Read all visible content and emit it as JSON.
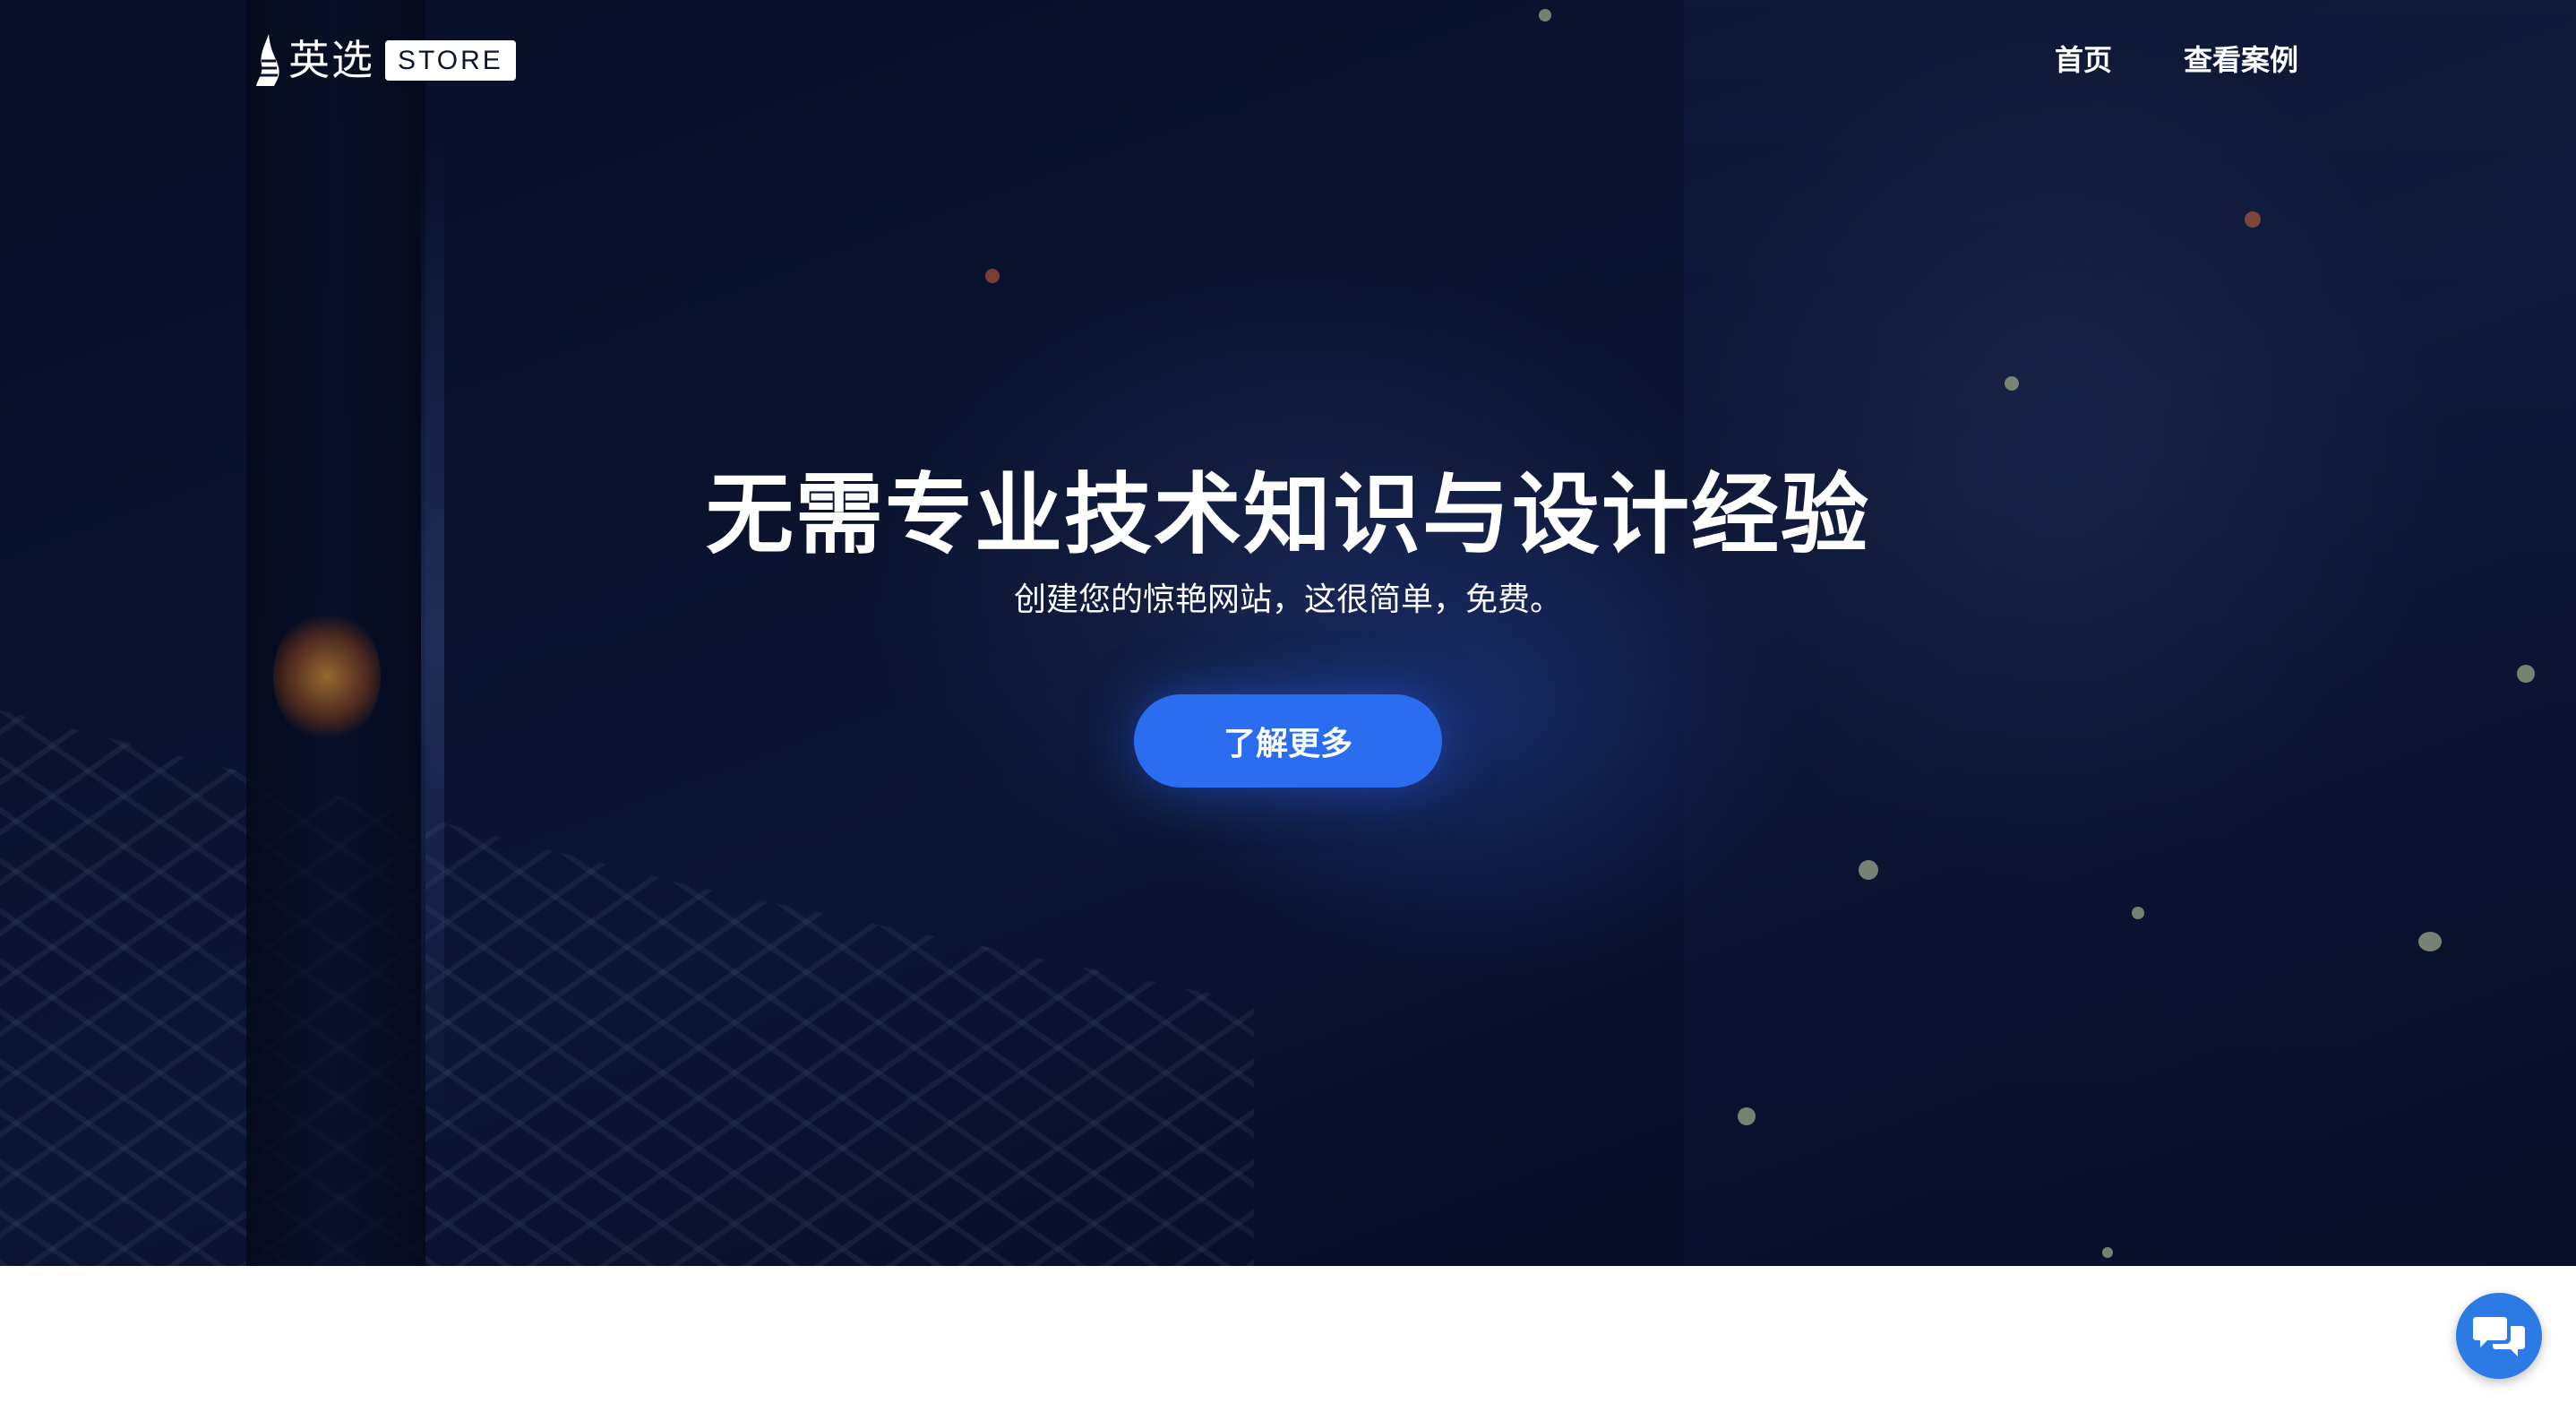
{
  "header": {
    "logo_text": "英选",
    "logo_badge": "STORE",
    "nav": [
      {
        "label": "首页"
      },
      {
        "label": "查看案例"
      }
    ]
  },
  "hero": {
    "title": "无需专业技术知识与设计经验",
    "subtitle": "创建您的惊艳网站，这很简单，免费。",
    "cta_label": "了解更多"
  },
  "colors": {
    "accent": "#2a6df0",
    "chat_button": "#2c7be5"
  },
  "icons": {
    "logo": "flame-logo-icon",
    "chat": "chat-bubbles-icon"
  }
}
